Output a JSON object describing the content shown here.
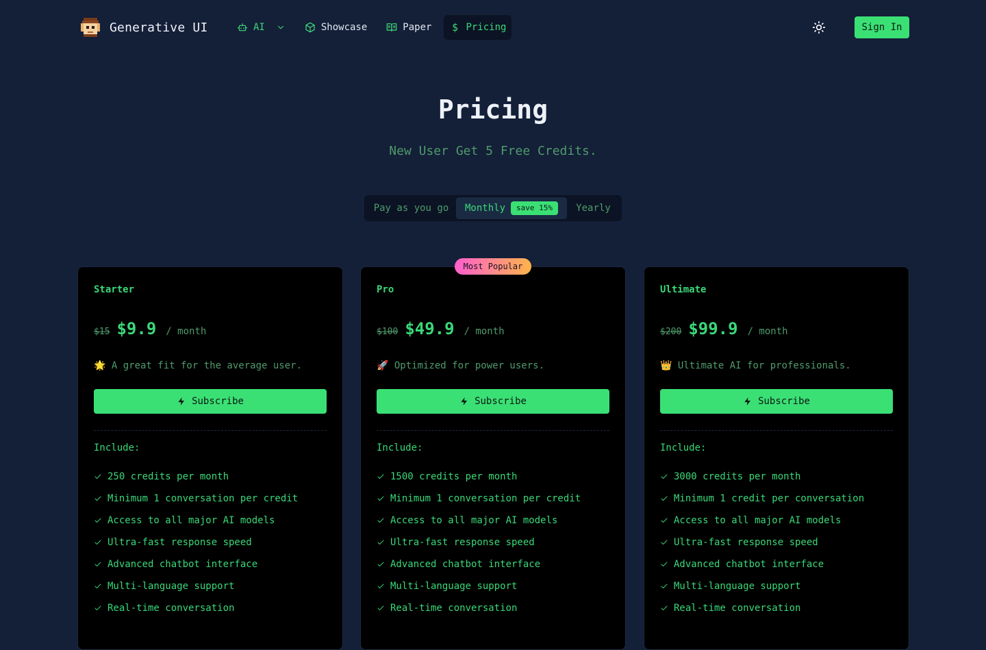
{
  "header": {
    "brand_name": "Generative UI",
    "nav": [
      {
        "label": "AI",
        "icon": "robot-icon"
      },
      {
        "label": "Showcase",
        "icon": "cube-icon"
      },
      {
        "label": "Paper",
        "icon": "book-icon"
      },
      {
        "label": "Pricing",
        "icon": "dollar-icon",
        "active": true
      }
    ],
    "sign_in_label": "Sign In"
  },
  "hero": {
    "title": "Pricing",
    "subtitle": "New User Get 5 Free Credits."
  },
  "billing": {
    "options": [
      "Pay as you go",
      "Monthly",
      "Yearly"
    ],
    "selected": "Monthly",
    "save_badge": "save 15%"
  },
  "popular_badge": "Most Popular",
  "plans": [
    {
      "name": "Starter",
      "old_price": "$15",
      "price": "$9.9",
      "period": "/ month",
      "tagline": "🌟 A great fit for the average user.",
      "button": "Subscribe",
      "include_label": "Include:",
      "features": [
        "250 credits per month",
        "Minimum 1 conversation per credit",
        "Access to all major AI models",
        "Ultra-fast response speed",
        "Advanced chatbot interface",
        "Multi-language support",
        "Real-time conversation"
      ]
    },
    {
      "name": "Pro",
      "old_price": "$100",
      "price": "$49.9",
      "period": "/ month",
      "tagline": "🚀 Optimized for power users.",
      "button": "Subscribe",
      "include_label": "Include:",
      "features": [
        "1500 credits per month",
        "Minimum 1 conversation per credit",
        "Access to all major AI models",
        "Ultra-fast response speed",
        "Advanced chatbot interface",
        "Multi-language support",
        "Real-time conversation"
      ]
    },
    {
      "name": "Ultimate",
      "old_price": "$200",
      "price": "$99.9",
      "period": "/ month",
      "tagline": "👑 Ultimate AI for professionals.",
      "button": "Subscribe",
      "include_label": "Include:",
      "features": [
        "3000 credits per month",
        "Minimum 1 credit per conversation",
        "Access to all major AI models",
        "Ultra-fast response speed",
        "Advanced chatbot interface",
        "Multi-language support",
        "Real-time conversation"
      ]
    }
  ],
  "colors": {
    "background": "#141f38",
    "accent": "#3be075",
    "card": "#000000"
  }
}
